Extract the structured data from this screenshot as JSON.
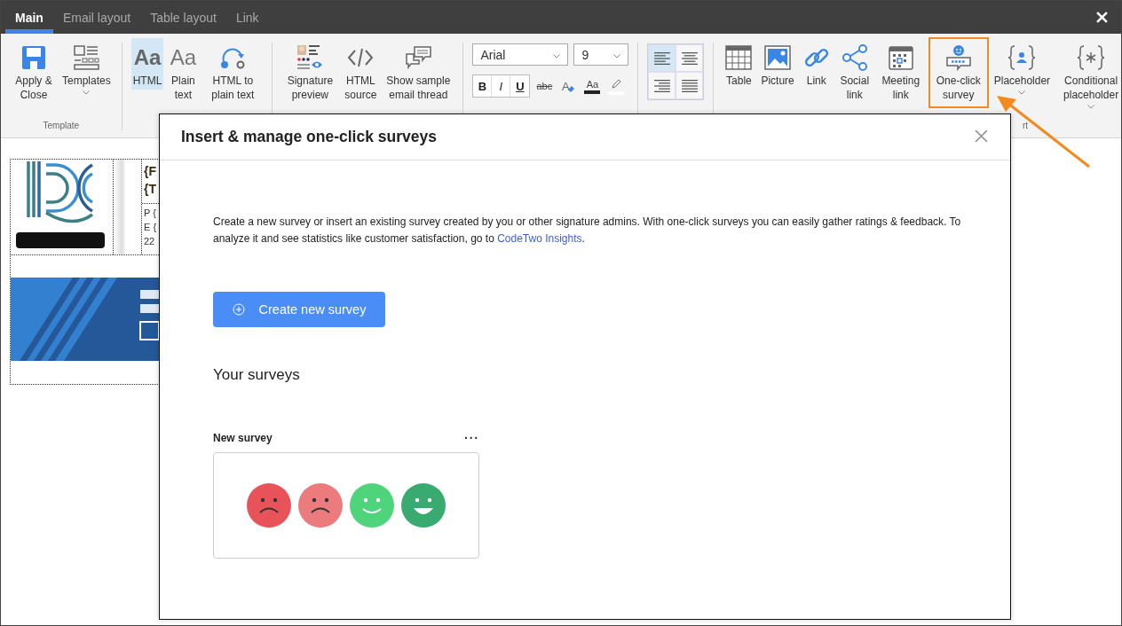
{
  "tabs": [
    {
      "label": "Main",
      "selected": true
    },
    {
      "label": "Email layout",
      "selected": false
    },
    {
      "label": "Table layout",
      "selected": false
    },
    {
      "label": "Link",
      "selected": false
    }
  ],
  "ribbon": {
    "groups": [
      {
        "label": "Template",
        "items": [
          {
            "kind": "save",
            "label": "Apply & Close",
            "selected": false
          },
          {
            "kind": "templates",
            "label": "Templates",
            "selected": false,
            "caret": true
          }
        ]
      },
      {
        "items": [
          {
            "kind": "html",
            "glyph": "Aa",
            "label": "HTML",
            "selected": true
          },
          {
            "kind": "plain",
            "glyph": "Aa",
            "label": "Plain text",
            "selected": false
          },
          {
            "kind": "convert",
            "label": "HTML to plain text",
            "selected": false
          }
        ]
      },
      {
        "items": [
          {
            "kind": "preview",
            "label": "Signature preview",
            "selected": false
          },
          {
            "kind": "source",
            "label": "HTML source",
            "selected": false
          },
          {
            "kind": "thread",
            "label": "Show sample email thread",
            "selected": false
          }
        ]
      },
      {
        "kind": "font",
        "font": "Arial",
        "size": "9",
        "buttons": [
          {
            "kind": "bold",
            "label": "B"
          },
          {
            "kind": "italic",
            "label": "I"
          },
          {
            "kind": "underline",
            "label": "U"
          },
          {
            "kind": "strike",
            "label": "abc"
          },
          {
            "kind": "clear",
            "label": "A"
          },
          {
            "kind": "color",
            "label": "Aa"
          },
          {
            "kind": "highlight"
          }
        ]
      },
      {
        "kind": "align",
        "buttons": [
          {
            "kind": "left",
            "selected": true
          },
          {
            "kind": "center",
            "selected": false
          },
          {
            "kind": "right",
            "selected": false
          },
          {
            "kind": "justify",
            "selected": false
          }
        ]
      },
      {
        "label": "rt",
        "items": [
          {
            "kind": "table",
            "label": "Table",
            "selected": false
          },
          {
            "kind": "picture",
            "label": "Picture",
            "selected": false
          },
          {
            "kind": "link",
            "label": "Link",
            "selected": false
          },
          {
            "kind": "social",
            "label": "Social link",
            "selected": false
          },
          {
            "kind": "meeting",
            "label": "Meeting link",
            "selected": false
          },
          {
            "kind": "survey",
            "label": "One-click survey",
            "selected": false,
            "highlighted": true
          },
          {
            "kind": "placeholder",
            "label": "Placeholder",
            "selected": false,
            "caret": true
          },
          {
            "kind": "conditional",
            "label": "Conditional placeholder",
            "selected": false,
            "caret": true
          }
        ]
      }
    ]
  },
  "signature": {
    "name_lines": [
      "{F",
      "{T"
    ],
    "detail_lines": [
      "P {",
      "E {",
      "22"
    ]
  },
  "dialog": {
    "title": "Insert & manage one-click surveys",
    "description": {
      "text": "Create a new survey or insert an existing survey created by you or other signature admins. With one-click surveys you can easily gather ratings & feedback. To analyze it and see statistics like customer satisfaction, go to ",
      "link": "CodeTwo Insights",
      "after": "."
    },
    "create_button": "Create new survey",
    "section_title": "Your surveys",
    "surveys": [
      {
        "name": "New survey",
        "menu": "···",
        "faces": [
          {
            "kind": "sad",
            "color": "#e8535a"
          },
          {
            "kind": "sad",
            "color": "#ec7b7e"
          },
          {
            "kind": "smile",
            "color": "#4fd47c"
          },
          {
            "kind": "grin",
            "color": "#3aab70"
          }
        ]
      }
    ]
  }
}
